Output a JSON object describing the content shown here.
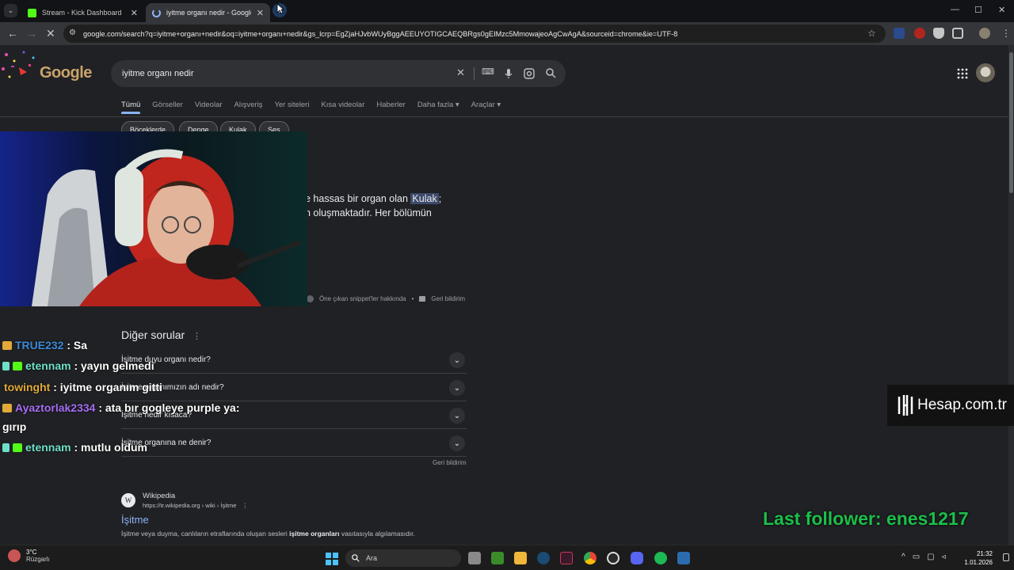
{
  "browser": {
    "tabs": [
      {
        "title": "Stream - Kick Dashboard",
        "close": "✕"
      },
      {
        "title": "iyitme organı nedir - Google'da",
        "close": "✕"
      }
    ],
    "new_tab": "+",
    "window_controls": {
      "minimize": "—",
      "maximize": "☐",
      "close": "✕"
    },
    "url": "google.com/search?q=iyitme+organı+nedir&oq=iyitme+organı+nedir&gs_lcrp=EgZjaHJvbWUyBggAEEUYOTIGCAEQBRgs0gEIMzc5MmowajeoAgCwAgA&sourceid=chrome&ie=UTF-8",
    "menu": "⋮"
  },
  "google": {
    "logo_text": "Google",
    "query": "iyitme organı nedir",
    "tabs": [
      "Tümü",
      "Görseller",
      "Videolar",
      "Alışveriş",
      "Yer siteleri",
      "Kısa videolar",
      "Haberler",
      "Daha fazla ▾",
      "Araçlar ▾"
    ],
    "chips": [
      "Böceklerde",
      "Denge",
      "Kulak",
      "Ses"
    ],
    "snippet": {
      "line1_pre": "e hassas bir organ olan ",
      "line1_highlight": "Kulak",
      "line1_post": ";",
      "line2": "n oluşmaktadır. Her bölümün"
    },
    "snippet_footer": {
      "about": "Öne çıkan snippet'ler hakkında",
      "separator": "•",
      "feedback": "Geri bildirim"
    },
    "paa": {
      "title": "Diğer sorular",
      "menu": "⋮",
      "questions": [
        "İşitme duyu organı nedir?",
        "İşitme organımızın adı nedir?",
        "İşitme nedir kısaca?",
        "İşitme organına ne denir?"
      ],
      "chevron": "⌄",
      "feedback": "Geri bildirim"
    },
    "result": {
      "favicon": "W",
      "site": "Wikipedia",
      "url": "https://tr.wikipedia.org › wiki › İşitme",
      "menu": "⋮",
      "title": "İşitme",
      "snippet_pre": "İşitme veya duyma, canlıların etraflarında oluşan sesleri ",
      "snippet_bold": "işitme organları",
      "snippet_post": " vasıtasıyla algılamasıdır."
    }
  },
  "chat": [
    {
      "user": "TRUE232",
      "msg": " : Sa",
      "user_color": "#3d8bd9"
    },
    {
      "user": "etennam",
      "msg": " : yayın gelmedi",
      "user_color": "#6ee0c8"
    },
    {
      "user": "towinght",
      "msg": " : iyitme organım gitti",
      "user_color": "#e2a93a"
    },
    {
      "user": "Ayaztorlak2334",
      "msg": " : ata bır gogleye purple ya:",
      "user_color": "#a66ef5"
    },
    {
      "user": "",
      "msg": "gırıp",
      "user_color": "#ffffff"
    },
    {
      "user": "etennam",
      "msg": " : mutlu oldum",
      "user_color": "#6ee0c8"
    }
  ],
  "overlay": {
    "hesap": "Hesap.com.tr",
    "last_follower": "Last follower: enes1217"
  },
  "taskbar": {
    "weather_temp": "3°C",
    "weather_desc": "Rüzgarlı",
    "search": "Ara",
    "tray_chevron": "^",
    "time": "21:32",
    "date": "1.01.2026"
  },
  "colors": {
    "accent_blue": "#8ab4f8",
    "kick_green": "#53fc18",
    "follower_green": "#1bbf4a"
  }
}
